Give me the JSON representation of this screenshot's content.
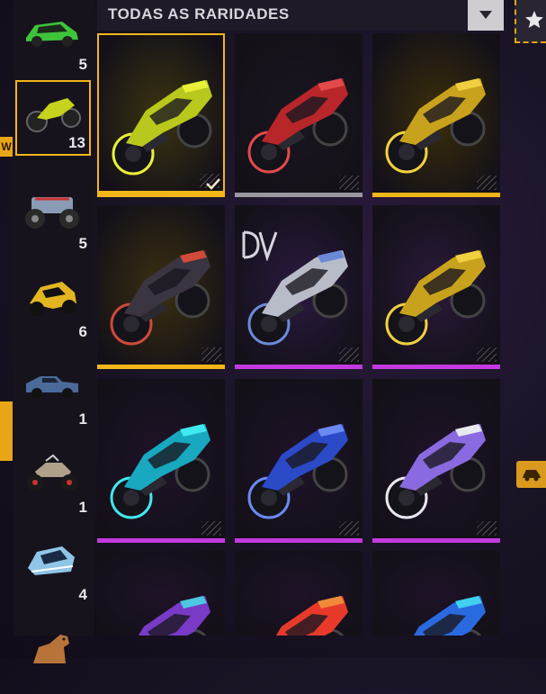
{
  "filter": {
    "label": "TODAS AS RARIDADES"
  },
  "edge_tab_label": "W",
  "categories": [
    {
      "icon": "green-car-icon",
      "count": "5",
      "color": "#3ec43a"
    },
    {
      "icon": "motorcycle-icon",
      "count": "13",
      "color": "#c7d21c",
      "selected": true
    },
    {
      "icon": "monster-truck-icon",
      "count": "5",
      "color": "#8a9bb5"
    },
    {
      "icon": "gold-buggy-icon",
      "count": "6",
      "color": "#e2b521"
    },
    {
      "icon": "pickup-truck-icon",
      "count": "1",
      "color": "#4a6a9a"
    },
    {
      "icon": "atv-icon",
      "count": "1",
      "color": "#b0a08a"
    },
    {
      "icon": "jet-ski-icon",
      "count": "4",
      "color": "#8fc6e8"
    },
    {
      "icon": "horse-icon",
      "count": "",
      "color": "#b8733a"
    }
  ],
  "items": [
    {
      "name": "yellow-green-motorcycle",
      "body": "#b9c81c",
      "accent": "#e8f03a",
      "bg": "#3a3410",
      "rarity": "#f2b619",
      "equipped": true
    },
    {
      "name": "red-motorcycle",
      "body": "#b8262a",
      "accent": "#e24a4a",
      "bg": "#1a1620",
      "rarity": "#9a97a0"
    },
    {
      "name": "gold-motorcycle",
      "body": "#c9a21d",
      "accent": "#f0d040",
      "bg": "#3a2e0a",
      "rarity": "#f2b619"
    },
    {
      "name": "dark-gold-motorcycle",
      "body": "#3a3540",
      "accent": "#d04a3a",
      "bg": "#3a3010",
      "rarity": "#f2b619"
    },
    {
      "name": "silver-logo-motorcycle",
      "body": "#b8bcc8",
      "accent": "#6a8ad8",
      "bg": "#2a1a40",
      "rarity": "#c23adf",
      "logo": true
    },
    {
      "name": "gold-wheel-motorcycle",
      "body": "#c9a21d",
      "accent": "#f0d040",
      "bg": "#2a1a3a",
      "rarity": "#c23adf"
    },
    {
      "name": "cyan-motorcycle",
      "body": "#18a8c0",
      "accent": "#40e8f0",
      "bg": "#1e1228",
      "rarity": "#c23adf"
    },
    {
      "name": "blue-motorcycle",
      "body": "#2a4ac8",
      "accent": "#6a8af0",
      "bg": "#1e1228",
      "rarity": "#c23adf"
    },
    {
      "name": "purple-white-motorcycle",
      "body": "#8a6ae0",
      "accent": "#e8e8f0",
      "bg": "#1e1228",
      "rarity": "#c23adf"
    },
    {
      "name": "purple-motorcycle",
      "body": "#7a3ac8",
      "accent": "#4ac8e0",
      "bg": "#1e1228",
      "rarity": "#c23adf"
    },
    {
      "name": "red-orange-motorcycle",
      "body": "#e83a2a",
      "accent": "#f08a3a",
      "bg": "#1e1228",
      "rarity": "#c23adf"
    },
    {
      "name": "blue-cyan-motorcycle",
      "body": "#2a6ae0",
      "accent": "#40d0f0",
      "bg": "#1e1228",
      "rarity": "#c23adf"
    }
  ]
}
